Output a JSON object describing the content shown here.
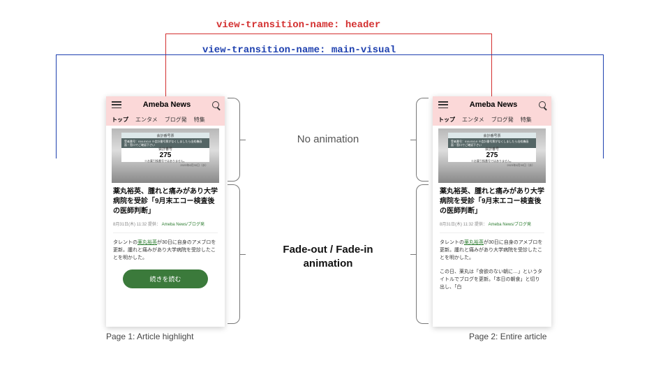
{
  "annotations": {
    "header_label": "view-transition-name: header",
    "visual_label": "view-transition-name: main-visual",
    "no_anim": "No animation",
    "fade_anim": "Fade-out / Fade-in animation"
  },
  "captions": {
    "page1": "Page 1: Article highlight",
    "page2": "Page 2: Entire article"
  },
  "phone": {
    "site_title": "Ameba News",
    "nav": [
      "トップ",
      "エンタメ",
      "ブログ発",
      "特集"
    ],
    "ticket": {
      "top": "会計番号票",
      "mid": "受者番号：016-010-0\n※会計番号票がなくしましたら出処機画面・窓口でご確認下さい",
      "num_label": "会計番号",
      "num": "275",
      "note": "※お薬引換番号ではありません。",
      "date": "2023年8月30日（水）"
    },
    "headline": "薬丸裕英、腫れと痛みがあり大学病院を受診「9月末エコー検査後の医師判断」",
    "date": "8月31日(木) 11:32",
    "provider_label": "提供：",
    "provider": "Ameba News/ブログ発",
    "snippet_pre": "タレントの",
    "snippet_link": "薬丸裕英",
    "snippet_post": "が30日に自身のアメブロを更新。腫れと痛みがあり大学病院を受診したことを明かした。",
    "cta": "続きを読む",
    "body2": "この日、薬丸は「食欲のない朝に…」というタイトルでブログを更新。「本日の朝食」と切り出し、「白"
  }
}
